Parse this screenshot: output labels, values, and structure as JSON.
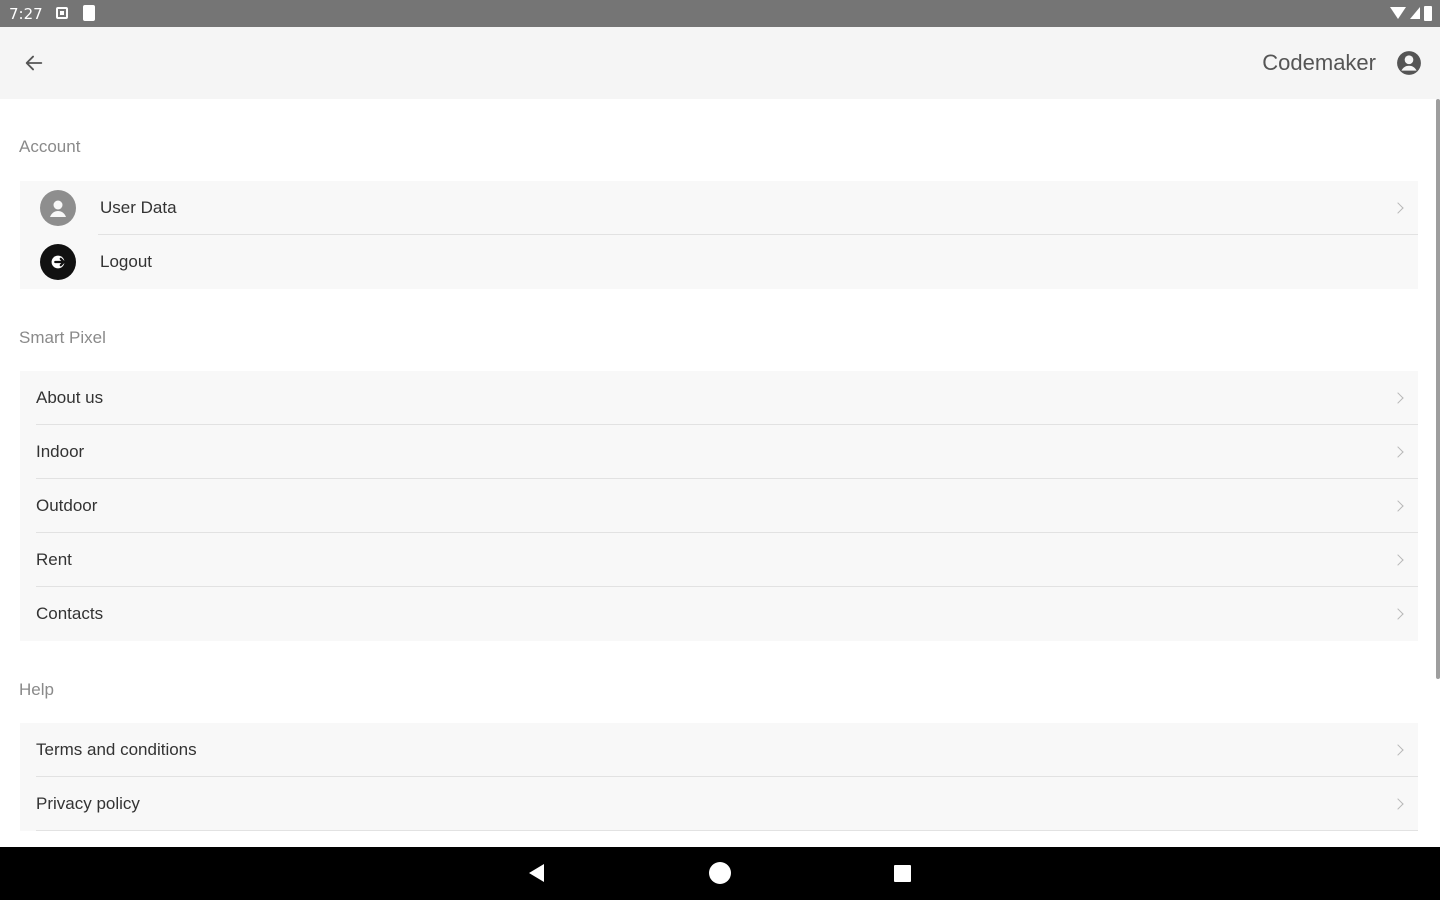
{
  "status_bar": {
    "time": "7:27"
  },
  "app_bar": {
    "user_name": "Codemaker"
  },
  "sections": {
    "account": {
      "title": "Account",
      "items": [
        {
          "label": "User Data",
          "icon": "person-icon",
          "chevron": true
        },
        {
          "label": "Logout",
          "icon": "logout-icon",
          "chevron": false
        }
      ]
    },
    "smart_pixel": {
      "title": "Smart Pixel",
      "items": [
        {
          "label": "About us"
        },
        {
          "label": "Indoor"
        },
        {
          "label": "Outdoor"
        },
        {
          "label": "Rent"
        },
        {
          "label": "Contacts"
        }
      ]
    },
    "help": {
      "title": "Help",
      "items": [
        {
          "label": "Terms and conditions"
        },
        {
          "label": "Privacy policy"
        }
      ]
    }
  },
  "colors": {
    "status_bar": "#757575",
    "app_bar": "#f5f5f5",
    "card": "#f8f8f8",
    "section_title": "#8a8a8a",
    "nav_bar": "#000000"
  }
}
